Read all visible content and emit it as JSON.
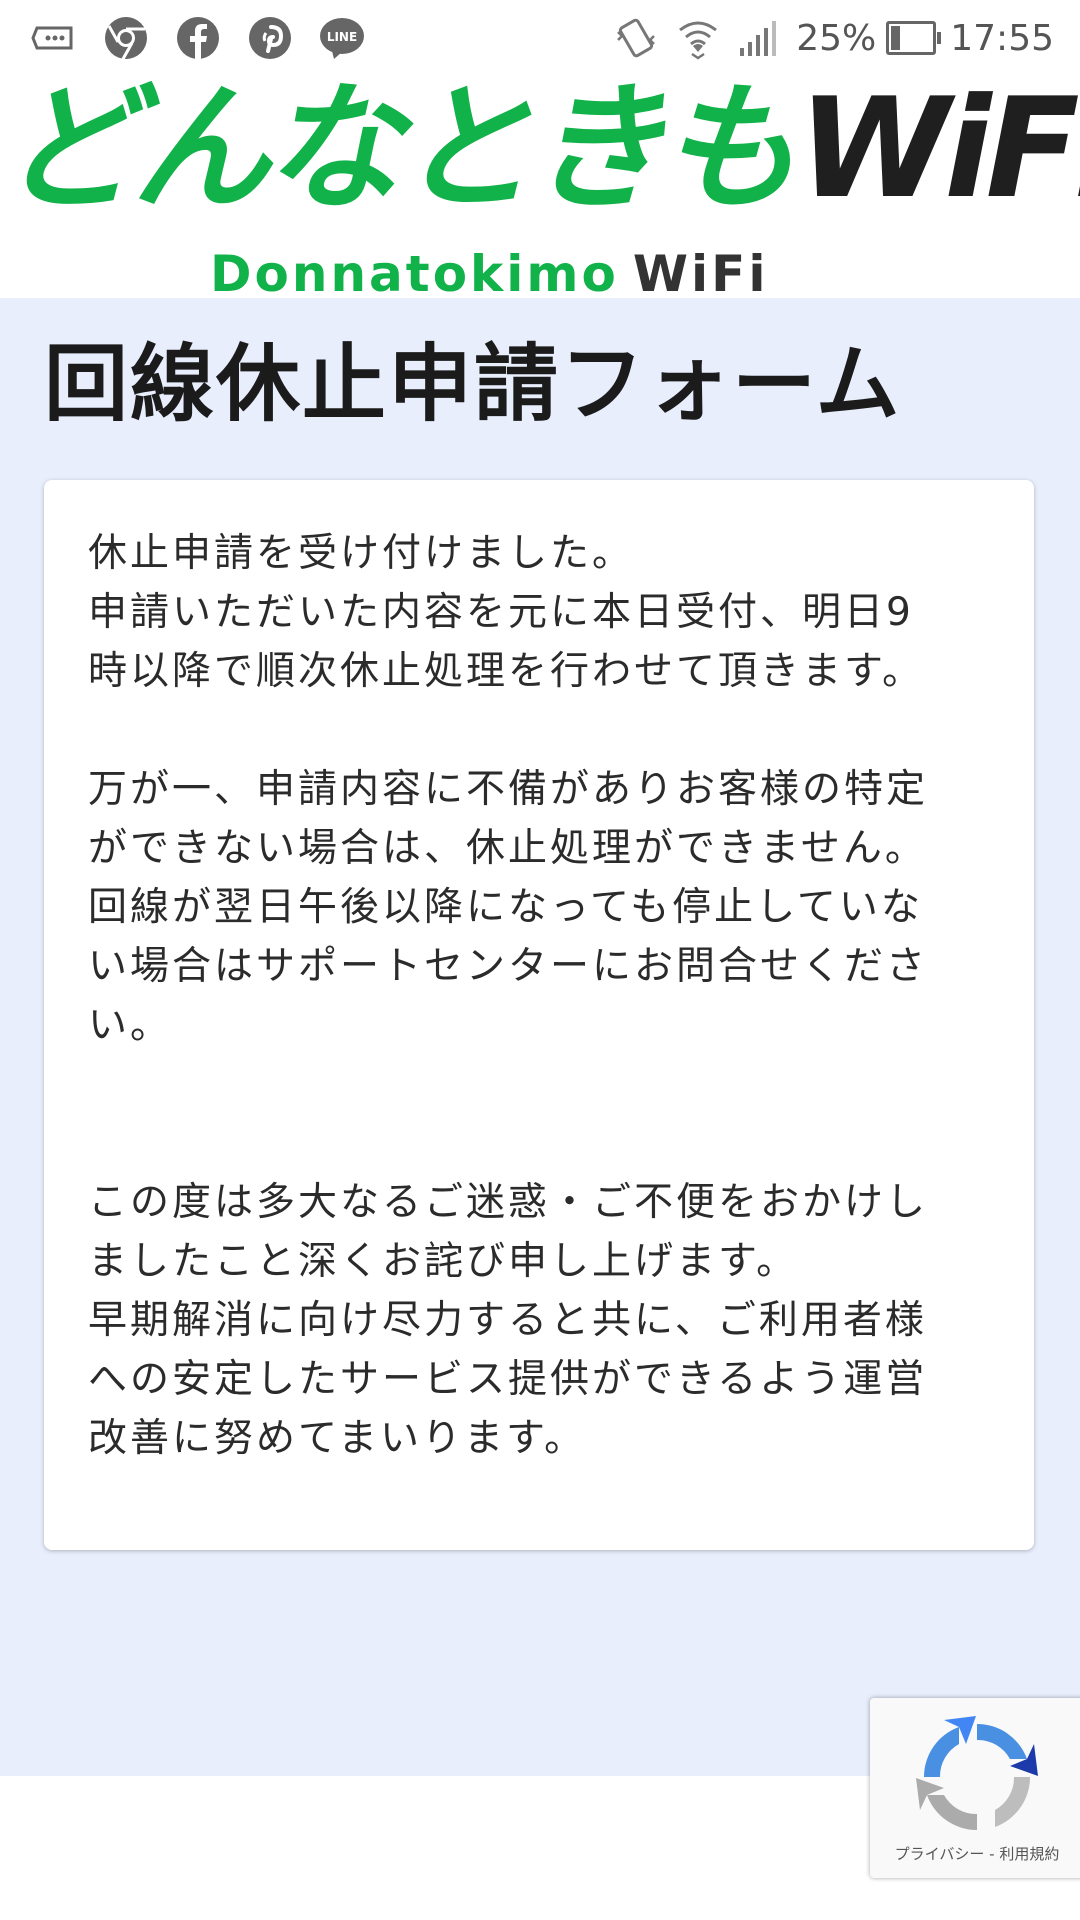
{
  "status_bar": {
    "battery_percent": "25%",
    "time": "17:55",
    "icons": [
      "message-icon",
      "chrome-icon",
      "facebook-icon",
      "pinterest-icon",
      "line-icon",
      "vibrate-icon",
      "wifi-icon",
      "signal-icon",
      "battery-icon"
    ],
    "line_badge": "LINE"
  },
  "logo": {
    "jp_text": "どんなときも",
    "wifi_text": "WiFi",
    "sub_green": "Donnatokimo",
    "sub_dark": "WiFi"
  },
  "page": {
    "title": "回線休止申請フォーム"
  },
  "message": {
    "p1": [
      "休止申請を受け付けました。",
      "申請いただいた内容を元に本日受付、明日9",
      "時以降で順次休止処理を行わせて頂きます。"
    ],
    "p2": [
      "万が一、申請内容に不備がありお客様の特定",
      "ができない場合は、休止処理ができません。",
      "回線が翌日午後以降になっても停止していな",
      "い場合はサポートセンターにお問合せくださ",
      "い。"
    ],
    "p3": [
      "この度は多大なるご迷惑・ご不便をおかけし",
      "ましたこと深くお詫び申し上げます。",
      "早期解消に向け尽力すると共に、ご利用者様",
      "への安定したサービス提供ができるよう運営",
      "改善に努めてまいります。"
    ]
  },
  "recaptcha": {
    "links": "プライバシー - 利用規約"
  },
  "colors": {
    "brand_green": "#12b24a",
    "background": "#e8eefc",
    "recaptcha_blue": "#4a90e2"
  }
}
